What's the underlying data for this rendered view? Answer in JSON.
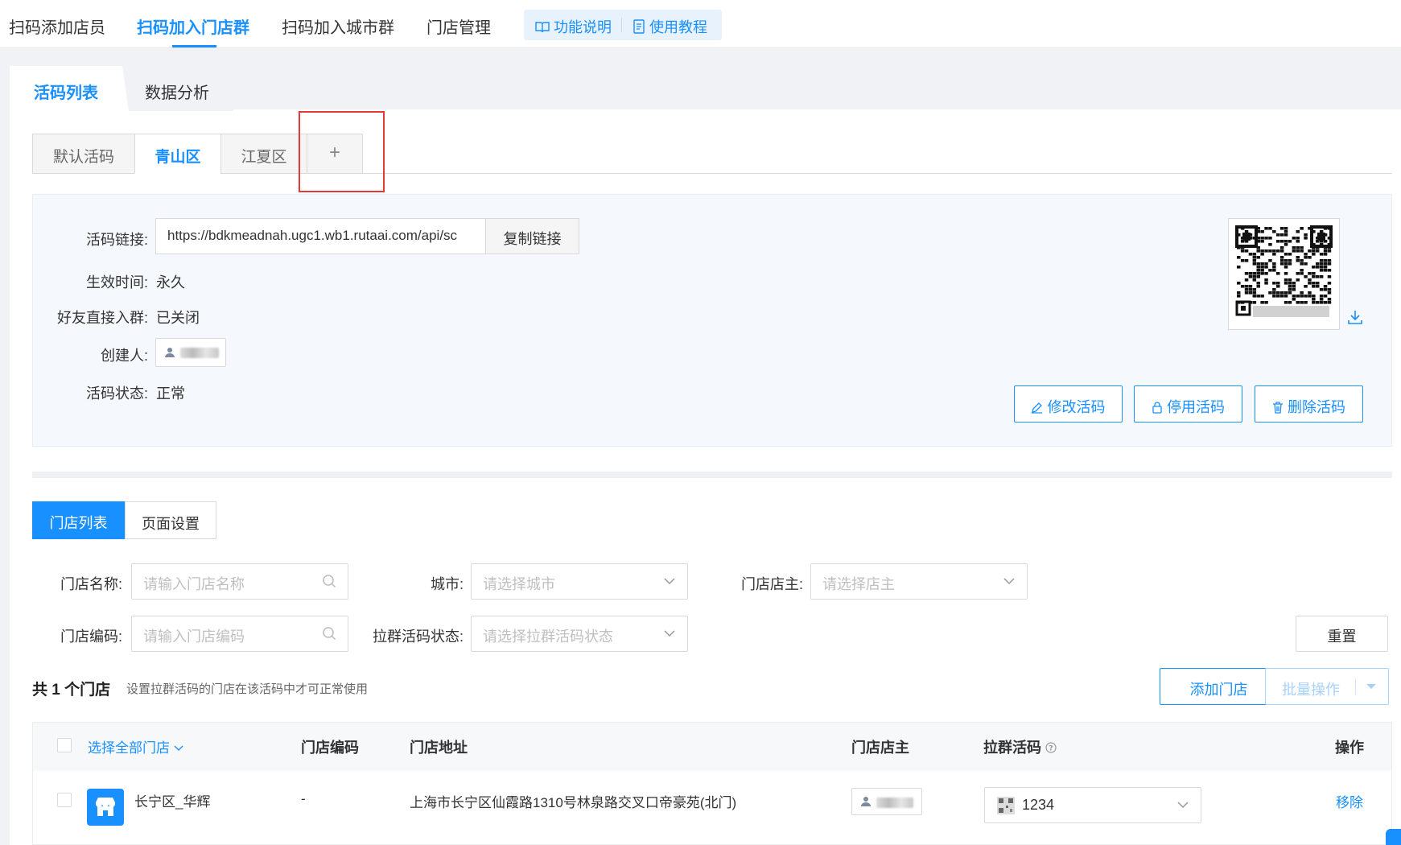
{
  "topnav": {
    "items": [
      "扫码添加店员",
      "扫码加入门店群",
      "扫码加入城市群",
      "门店管理"
    ],
    "help": [
      "功能说明",
      "使用教程"
    ]
  },
  "pagetabs": [
    "活码列表",
    "数据分析"
  ],
  "subtabs": [
    "默认活码",
    "青山区",
    "江夏区",
    "+"
  ],
  "info": {
    "link_label": "活码链接:",
    "link_value": "https://bdkmeadnah.ugc1.wb1.rutaai.com/api/sc",
    "copy_btn": "复制链接",
    "time_label": "生效时间:",
    "time_value": "永久",
    "join_label": "好友直接入群:",
    "join_value": "已关闭",
    "creator_label": "创建人:",
    "status_label": "活码状态:",
    "status_value": "正常",
    "btn_edit": "修改活码",
    "btn_disable": "停用活码",
    "btn_delete": "删除活码"
  },
  "listtabs": [
    "门店列表",
    "页面设置"
  ],
  "filters": {
    "name_label": "门店名称:",
    "name_ph": "请输入门店名称",
    "city_label": "城市:",
    "city_ph": "请选择城市",
    "owner_label": "门店店主:",
    "owner_ph": "请选择店主",
    "code_label": "门店编码:",
    "code_ph": "请输入门店编码",
    "qrstatus_label": "拉群活码状态:",
    "qrstatus_ph": "请选择拉群活码状态",
    "reset": "重置"
  },
  "summary": {
    "count": "共 1 个门店",
    "note": "设置拉群活码的门店在该活码中才可正常使用",
    "add_btn": "添加门店",
    "batch_btn": "批量操作"
  },
  "table": {
    "headers": {
      "select_all": "选择全部门店",
      "code": "门店编码",
      "address": "门店地址",
      "owner": "门店店主",
      "qrcode": "拉群活码",
      "ops": "操作"
    },
    "rows": [
      {
        "name": "长宁区_华辉",
        "code": "-",
        "address": "上海市长宁区仙霞路1310号林泉路交叉口帝豪苑(北门)",
        "qrcode": "1234",
        "op": "移除"
      }
    ]
  },
  "colors": {
    "accent": "#1890ff",
    "highlight": "#e53935"
  }
}
